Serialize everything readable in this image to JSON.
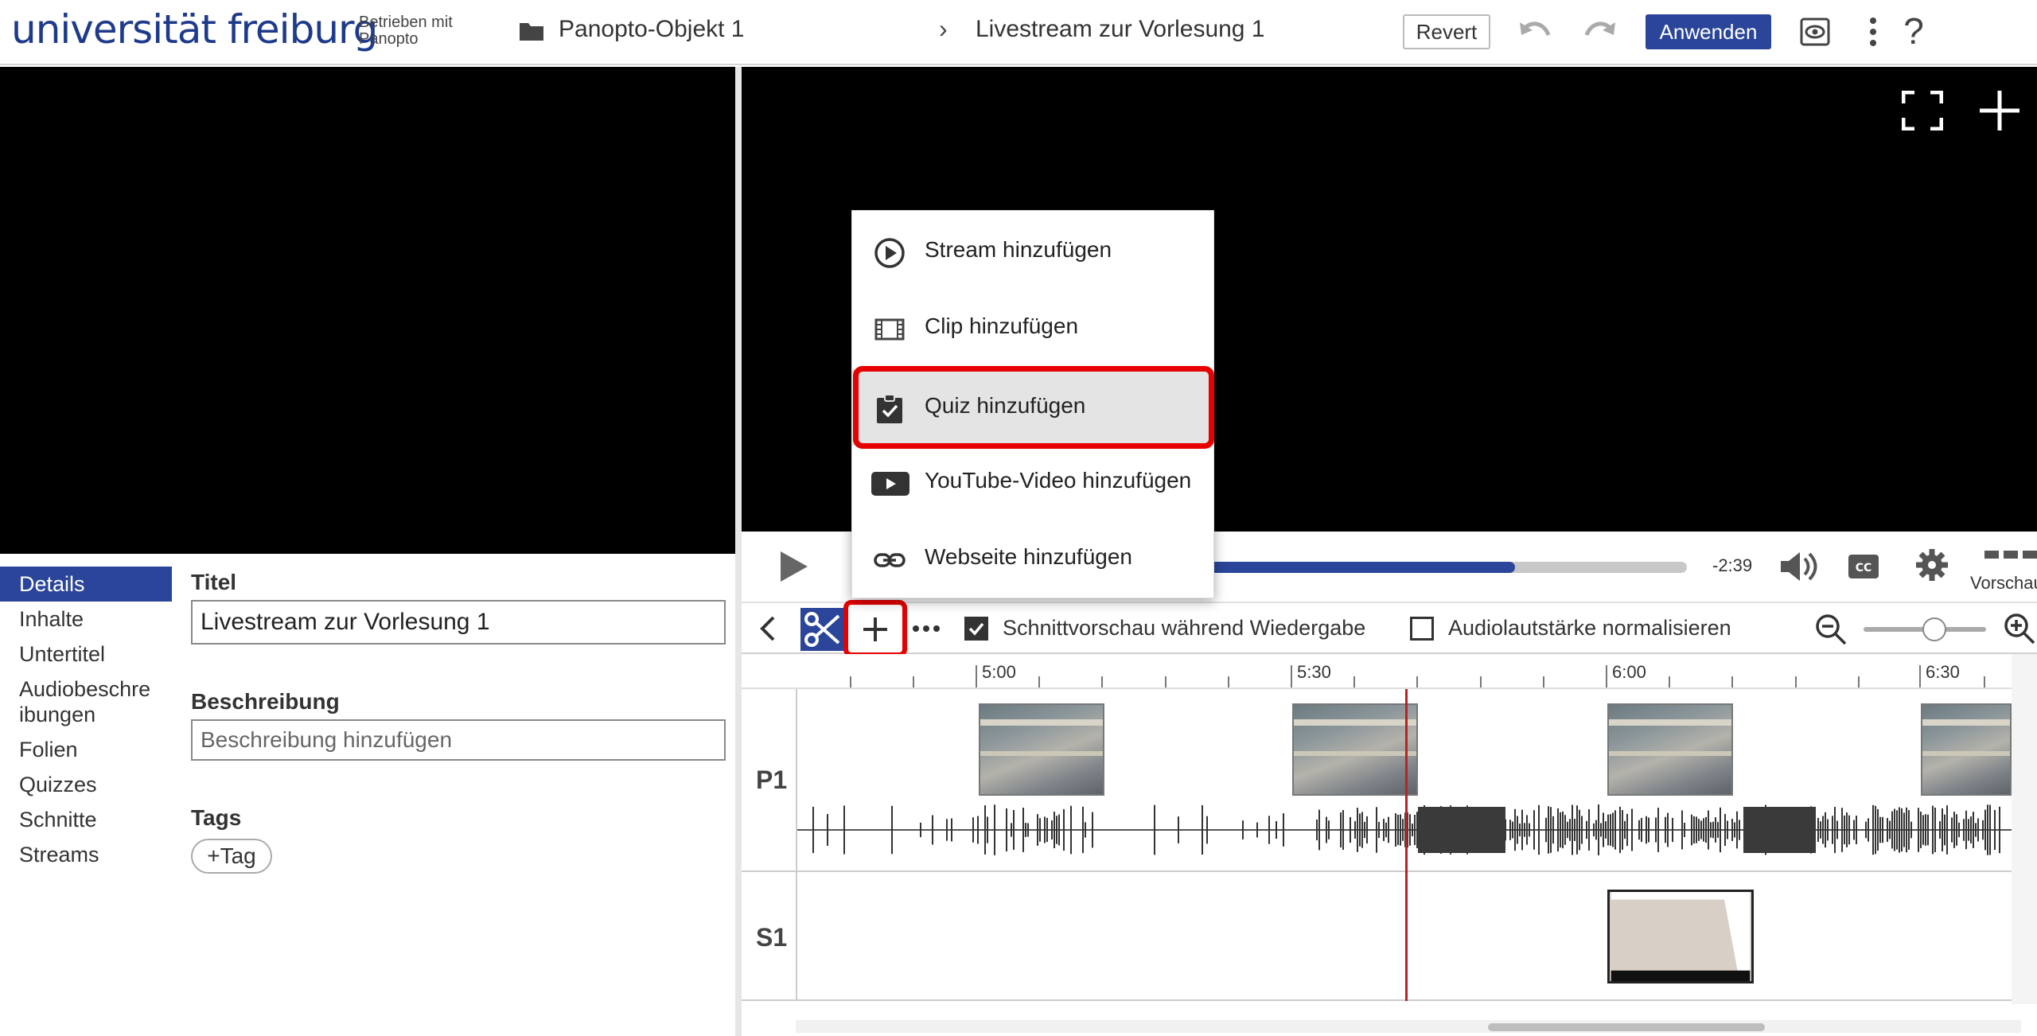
{
  "header": {
    "logo_text": "universität freiburg",
    "powered_by": "Betrieben mit Panopto",
    "folder_name": "Panopto-Objekt 1",
    "breadcrumb_separator": "›",
    "session_title": "Livestream zur Vorlesung 1",
    "revert_label": "Revert",
    "apply_label": "Anwenden",
    "help_label": "?"
  },
  "nav": {
    "items": [
      {
        "label": "Details",
        "active": true
      },
      {
        "label": "Inhalte"
      },
      {
        "label": "Untertitel"
      },
      {
        "label": "Audiobeschreibungen"
      },
      {
        "label": "Folien"
      },
      {
        "label": "Quizzes"
      },
      {
        "label": "Schnitte"
      },
      {
        "label": "Streams"
      }
    ]
  },
  "details": {
    "title_label": "Titel",
    "title_value": "Livestream zur Vorlesung 1",
    "description_label": "Beschreibung",
    "description_placeholder": "Beschreibung hinzufügen",
    "tags_label": "Tags",
    "add_tag_label": "+Tag"
  },
  "player": {
    "time_remaining": "-2:39",
    "progress_percent": 64,
    "preview_label": "Vorschau",
    "icons": [
      "play-icon",
      "volume-icon",
      "cc-icon",
      "gear-icon",
      "fullscreen-icon",
      "plus-icon"
    ]
  },
  "add_menu": {
    "items": [
      {
        "label": "Stream hinzufügen",
        "icon": "play-circle-icon"
      },
      {
        "label": "Clip hinzufügen",
        "icon": "film-icon"
      },
      {
        "label": "Quiz hinzufügen",
        "icon": "clipboard-check-icon",
        "highlighted": true
      },
      {
        "label": "YouTube-Video hinzufügen",
        "icon": "youtube-icon"
      },
      {
        "label": "Webseite hinzufügen",
        "icon": "link-icon"
      }
    ]
  },
  "editor_toolbar": {
    "cut_preview_label": "Schnittvorschau während Wiedergabe",
    "cut_preview_checked": true,
    "normalize_audio_label": "Audiolautstärke normalisieren",
    "normalize_audio_checked": false,
    "zoom_level_fraction": 0.58
  },
  "timeline": {
    "ticks": [
      "5:00",
      "5:30",
      "6:00",
      "6:30"
    ],
    "tracks": [
      {
        "label": "P1"
      },
      {
        "label": "S1"
      }
    ],
    "playhead_time": "5:41"
  },
  "colors": {
    "brand": "#1e3a8a",
    "accent": "#2a4599",
    "highlight": "#e60000",
    "playhead": "#b52525"
  }
}
